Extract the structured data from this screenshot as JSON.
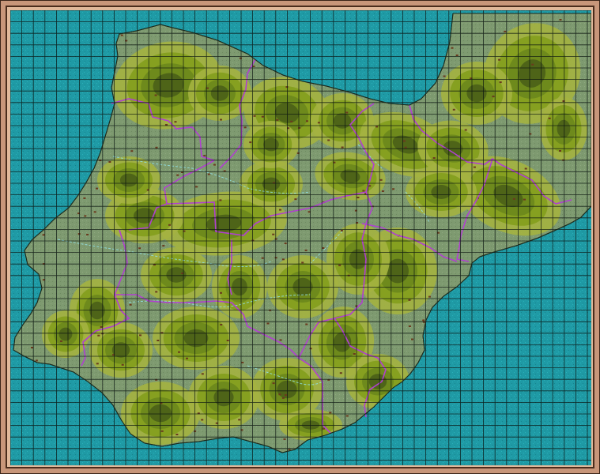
{
  "map": {
    "title": "",
    "colors": {
      "frame": "#c8967a",
      "frame_dark": "#4a2c1c",
      "sea": "#1f9aa5",
      "sea_speckle": "#2ab0b8",
      "plains": "#7e9a70",
      "hills_light": "#a4b240",
      "hills": "#86a020",
      "hills_dark": "#6e8a1c",
      "mountains": "#4e6418",
      "coast": "#1c2a1c",
      "border": "#b040d0",
      "river": "#8fe0e8",
      "grid": "#0a1410",
      "town": "#6a3a1e"
    },
    "icons": [
      "town-icon",
      "region-border",
      "river",
      "grid-cell"
    ]
  }
}
